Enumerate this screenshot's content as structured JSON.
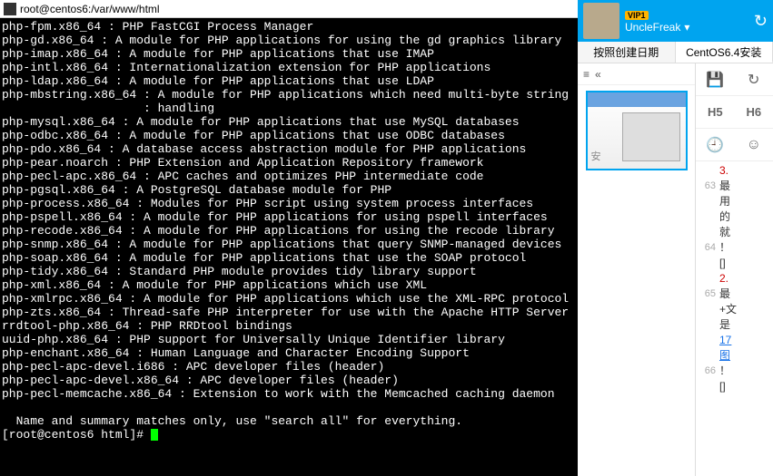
{
  "window": {
    "title": "root@centos6:/var/www/html"
  },
  "terminal": {
    "lines": [
      "php-fpm.x86_64 : PHP FastCGI Process Manager",
      "php-gd.x86_64 : A module for PHP applications for using the gd graphics library",
      "php-imap.x86_64 : A module for PHP applications that use IMAP",
      "php-intl.x86_64 : Internationalization extension for PHP applications",
      "php-ldap.x86_64 : A module for PHP applications that use LDAP",
      "php-mbstring.x86_64 : A module for PHP applications which need multi-byte string",
      "                    : handling",
      "php-mysql.x86_64 : A module for PHP applications that use MySQL databases",
      "php-odbc.x86_64 : A module for PHP applications that use ODBC databases",
      "php-pdo.x86_64 : A database access abstraction module for PHP applications",
      "php-pear.noarch : PHP Extension and Application Repository framework",
      "php-pecl-apc.x86_64 : APC caches and optimizes PHP intermediate code",
      "php-pgsql.x86_64 : A PostgreSQL database module for PHP",
      "php-process.x86_64 : Modules for PHP script using system process interfaces",
      "php-pspell.x86_64 : A module for PHP applications for using pspell interfaces",
      "php-recode.x86_64 : A module for PHP applications for using the recode library",
      "php-snmp.x86_64 : A module for PHP applications that query SNMP-managed devices",
      "php-soap.x86_64 : A module for PHP applications that use the SOAP protocol",
      "php-tidy.x86_64 : Standard PHP module provides tidy library support",
      "php-xml.x86_64 : A module for PHP applications which use XML",
      "php-xmlrpc.x86_64 : A module for PHP applications which use the XML-RPC protocol",
      "php-zts.x86_64 : Thread-safe PHP interpreter for use with the Apache HTTP Server",
      "rrdtool-php.x86_64 : PHP RRDtool bindings",
      "uuid-php.x86_64 : PHP support for Universally Unique Identifier library",
      "php-enchant.x86_64 : Human Language and Character Encoding Support",
      "php-pecl-apc-devel.i686 : APC developer files (header)",
      "php-pecl-apc-devel.x86_64 : APC developer files (header)",
      "php-pecl-memcache.x86_64 : Extension to work with the Memcached caching daemon",
      "",
      "  Name and summary matches only, use \"search all\" for everything.",
      "[root@centos6 html]# "
    ]
  },
  "right": {
    "vip": "VIP1",
    "username": "UncleFreak",
    "dropdown_glyph": "▾",
    "refresh_glyph": "↻",
    "tabs": {
      "active": "按照创建日期",
      "inactive": "CentOS6.4安装"
    },
    "sidebar": {
      "list_glyph": "≡",
      "collapse_glyph": "«"
    },
    "thumb_label": "安",
    "toolbar": {
      "save_glyph": "💾",
      "redo_glyph": "↻",
      "h5": "H5",
      "h6": "H6",
      "clock_glyph": "🕘",
      "smile_glyph": "☺"
    },
    "notes": [
      {
        "ln": "",
        "text": "3.",
        "cls": "red"
      },
      {
        "ln": "63",
        "text": "最"
      },
      {
        "ln": "",
        "text": "用"
      },
      {
        "ln": "",
        "text": "的"
      },
      {
        "ln": "",
        "text": "就"
      },
      {
        "ln": "64",
        "text": "！"
      },
      {
        "ln": "",
        "text": "[]"
      },
      {
        "ln": "",
        "text": "2.",
        "cls": "red"
      },
      {
        "ln": "65",
        "text": "最"
      },
      {
        "ln": "",
        "text": "+文"
      },
      {
        "ln": "",
        "text": "是"
      },
      {
        "ln": "",
        "text": "17",
        "cls": "blue"
      },
      {
        "ln": "",
        "text": "图",
        "cls": "blue"
      },
      {
        "ln": "66",
        "text": "！"
      },
      {
        "ln": "",
        "text": "[]"
      }
    ]
  }
}
